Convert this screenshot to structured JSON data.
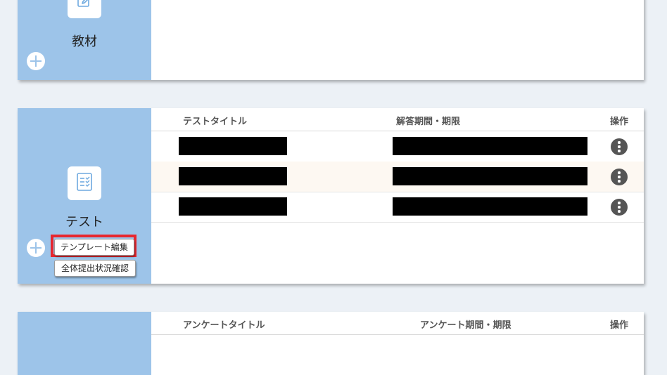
{
  "materials": {
    "label": "教材",
    "add_icon": "plus-circle-icon",
    "icon": "edit-icon"
  },
  "test": {
    "label": "テスト",
    "icon": "checklist-icon",
    "add_icon": "plus-circle-icon",
    "columns": {
      "title": "テストタイトル",
      "period": "解答期間・期限",
      "actions": "操作"
    },
    "rows": [
      {
        "title": "",
        "period": "",
        "actions_icon": "more-vertical-icon"
      },
      {
        "title": "",
        "period": "",
        "actions_icon": "more-vertical-icon"
      },
      {
        "title": "",
        "period": "",
        "actions_icon": "more-vertical-icon"
      }
    ],
    "template_edit_button": "テンプレート編集",
    "overall_status_button": "全体提出状況確認",
    "highlight_color": "#e8262e"
  },
  "survey": {
    "columns": {
      "title": "アンケートタイトル",
      "period": "アンケート期間・期限",
      "actions": "操作"
    }
  },
  "colors": {
    "sidebar": "#9dc4e9",
    "background": "#ecf1f6",
    "alt_row": "#fdf8f2"
  }
}
